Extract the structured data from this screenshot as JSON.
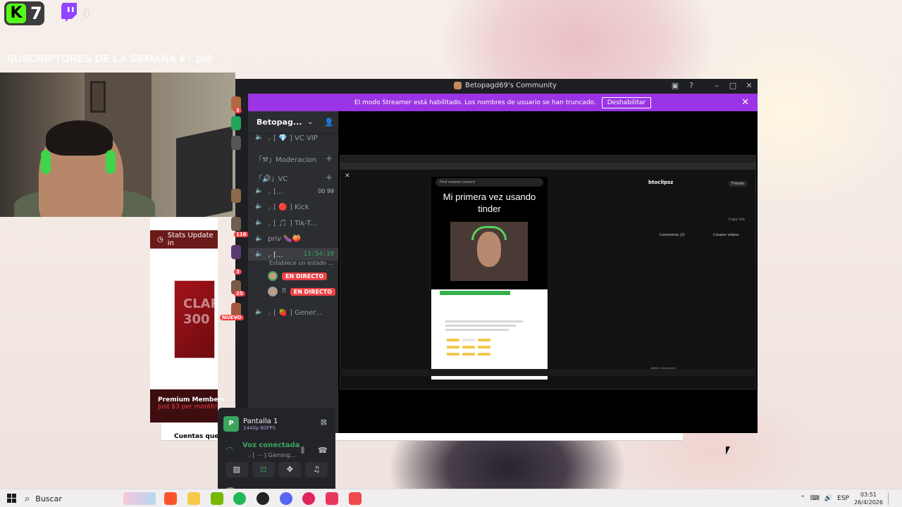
{
  "overlay": {
    "kick_letter": "K",
    "kick_count": "7",
    "twitch_count": "6",
    "subs_week": "SUSCRIPTORES DE LA SEMANA 6 / 100"
  },
  "discord": {
    "window_title": "Betopagd69's Community",
    "streamer_banner": "El modo Streamer está habilitado. Los nombres de usuario se han truncado.",
    "streamer_disable": "Deshabilitar",
    "server_name": "Betopag...",
    "server_badges": [
      "3",
      "116",
      "3",
      "25"
    ],
    "new_badge": "NUEVO",
    "channels": [
      {
        "label": "⸝ [ 💎 ] VC VIP"
      },
      {
        "label": "「⚒」Moderacion",
        "type": "category"
      },
      {
        "label": "「🔊」VC",
        "type": "category"
      },
      {
        "label": "⸝ [...",
        "count": "00 99"
      },
      {
        "label": "⸝ [ 🔴 ] Kick"
      },
      {
        "label": "⸝ [ 🎵 ] Tik-T..."
      },
      {
        "label": "priv 🍆🍑"
      },
      {
        "label": "⸝ [...",
        "time": "13:54:19"
      },
      {
        "label": "⸝ [ 🍓 ] Gener..."
      }
    ],
    "status_placeholder": "Establece un estado ...",
    "live_label": "EN DIRECTO",
    "live_user_2": "fl",
    "stream": {
      "title": "Pantalla 1",
      "quality": "1440p 60FPS"
    },
    "voice": {
      "title": "Voz conectada",
      "subtitle": "⸝ [ ⋯ ] Gaming..."
    },
    "user": {
      "name": "V."
    }
  },
  "stream_view": {
    "search_placeholder": "Find related content",
    "video_caption": "Mi primera vez usando tinder",
    "channel_name": "btoclipsz",
    "friends_label": "Friends",
    "comments_tab": "Comments (2)",
    "creator_tab": "Creator videos",
    "copy_link": "Copy link",
    "add_comment": "Add comment..."
  },
  "website": {
    "stats_update": "Stats Update in",
    "promo_text": "CLAR 300",
    "premium_title": "Premium Members",
    "premium_price": "Just $3 per month!",
    "following": "Cuentas que sigues"
  },
  "taskbar": {
    "search_label": "Buscar",
    "language": "ESP",
    "time": "03:51",
    "date": "26/4/2026"
  }
}
